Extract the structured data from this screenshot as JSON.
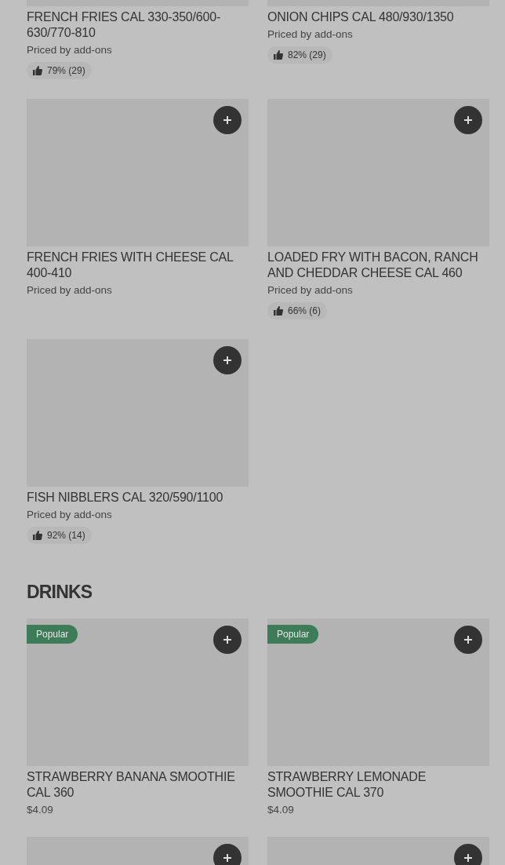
{
  "sections": [
    {
      "items": [
        {
          "kind": "cropped_dish",
          "title": "FRENCH FRIES CAL 330-350/600-630/770-810",
          "price": "Priced by add-ons",
          "rating": "79% (29)"
        },
        {
          "kind": "cropped_dish",
          "title": "ONION CHIPS CAL 480/930/1350",
          "price": "Priced by add-ons",
          "rating": "82% (29)"
        },
        {
          "kind": "dish",
          "title": "FRENCH FRIES WITH CHEESE CAL 400-410",
          "price": "Priced by add-ons"
        },
        {
          "kind": "dish",
          "title": "LOADED FRY WITH BACON, RANCH AND CHEDDAR CHEESE CAL 460",
          "price": "Priced by add-ons",
          "rating": "66% (6)"
        },
        {
          "kind": "dish",
          "title": "FISH NIBBLERS CAL 320/590/1100",
          "price": "Priced by add-ons",
          "rating": "92% (14)"
        }
      ]
    },
    {
      "heading": "DRINKS",
      "items": [
        {
          "kind": "dish",
          "badge": "Popular",
          "title": "STRAWBERRY BANANA SMOOTHIE CAL 360",
          "price": "$4.09"
        },
        {
          "kind": "dish",
          "badge": "Popular",
          "title": "STRAWBERRY LEMONADE SMOOTHIE CAL 370",
          "price": "$4.09"
        },
        {
          "kind": "picture"
        },
        {
          "kind": "picture"
        }
      ]
    }
  ]
}
